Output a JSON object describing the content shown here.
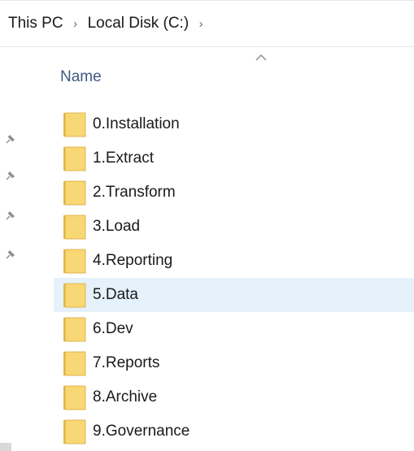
{
  "breadcrumb": {
    "items": [
      "This PC",
      "Local Disk (C:)"
    ],
    "separator": "›"
  },
  "columns": {
    "name_header": "Name",
    "sort_icon": "chevron-up-icon"
  },
  "quick_access_pins": [
    "pin-icon",
    "pin-icon",
    "pin-icon",
    "pin-icon"
  ],
  "folders": [
    {
      "name": "0.Installation",
      "selected": false
    },
    {
      "name": "1.Extract",
      "selected": false
    },
    {
      "name": "2.Transform",
      "selected": false
    },
    {
      "name": "3.Load",
      "selected": false
    },
    {
      "name": "4.Reporting",
      "selected": false
    },
    {
      "name": "5.Data",
      "selected": true
    },
    {
      "name": "6.Dev",
      "selected": false
    },
    {
      "name": "7.Reports",
      "selected": false
    },
    {
      "name": "8.Archive",
      "selected": false
    },
    {
      "name": "9.Governance",
      "selected": false
    }
  ],
  "colors": {
    "selection": "#e5f1fb",
    "folder_body": "#f8d775",
    "folder_back": "#e6b84a",
    "header_text": "#3d5a80"
  }
}
